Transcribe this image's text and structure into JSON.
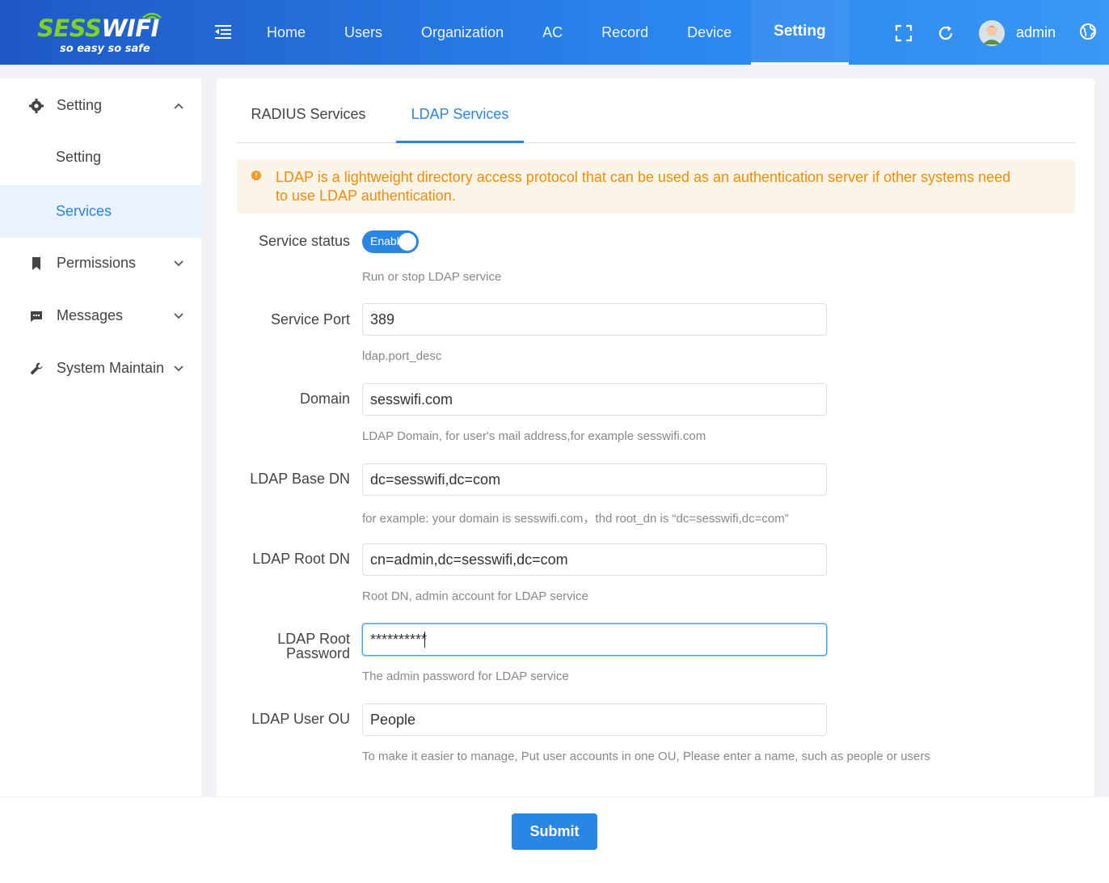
{
  "brand": {
    "name_part1": "SESS",
    "name_part2": "WIFI",
    "tagline": "so easy so safe",
    "accent": "#7ed321"
  },
  "nav": {
    "items": [
      {
        "label": "Home"
      },
      {
        "label": "Users"
      },
      {
        "label": "Organization"
      },
      {
        "label": "AC"
      },
      {
        "label": "Record"
      },
      {
        "label": "Device"
      },
      {
        "label": "Setting",
        "active": true
      }
    ]
  },
  "header_icons": [
    "menu-toggle-icon",
    "fullscreen-icon",
    "refresh-icon",
    "language-icon"
  ],
  "user": {
    "name": "admin"
  },
  "sidebar": {
    "groups": [
      {
        "label": "Setting",
        "icon": "gear-icon",
        "expanded": true,
        "children": [
          {
            "label": "Setting"
          },
          {
            "label": "Services",
            "active": true
          }
        ]
      },
      {
        "label": "Permissions",
        "icon": "bookmark-icon"
      },
      {
        "label": "Messages",
        "icon": "message-icon"
      },
      {
        "label": "System Maintain",
        "icon": "wrench-icon"
      }
    ]
  },
  "tabs": [
    {
      "label": "RADIUS Services"
    },
    {
      "label": "LDAP Services",
      "active": true
    }
  ],
  "alert": {
    "text": "LDAP is a lightweight directory access protocol that can be used as an authentication server if other systems need to use LDAP authentication."
  },
  "form": {
    "service_status": {
      "label": "Service status",
      "toggle_text": "Enabled",
      "enabled": true,
      "desc": "Run or stop LDAP service"
    },
    "service_port": {
      "label": "Service Port",
      "value": "389",
      "desc": "ldap.port_desc"
    },
    "domain": {
      "label": "Domain",
      "value": "sesswifi.com",
      "desc": "LDAP Domain, for user's mail address,for example sesswifi.com"
    },
    "base_dn": {
      "label": "LDAP Base DN",
      "value": "dc=sesswifi,dc=com",
      "desc": "for example: your domain is sesswifi.com，thd root_dn is “dc=sesswifi,dc=com”"
    },
    "root_dn": {
      "label": "LDAP Root DN",
      "value": "cn=admin,dc=sesswifi,dc=com",
      "desc": "Root DN, admin account for LDAP service"
    },
    "root_password": {
      "label_line1": "LDAP Root",
      "label_line2": "Password",
      "value": "**********",
      "desc": "The admin password for LDAP service"
    },
    "user_ou": {
      "label": "LDAP User OU",
      "value": "People",
      "desc": "To make it easier to manage, Put user accounts in one OU, Please enter a name, such as people or users"
    }
  },
  "footer": {
    "submit_label": "Submit"
  },
  "colors": {
    "primary": "#2a86e5",
    "header_start": "#1f58c7",
    "header_end": "#3a97f5",
    "warning_text": "#f08c0a",
    "warning_bg": "#fdf4e8"
  }
}
